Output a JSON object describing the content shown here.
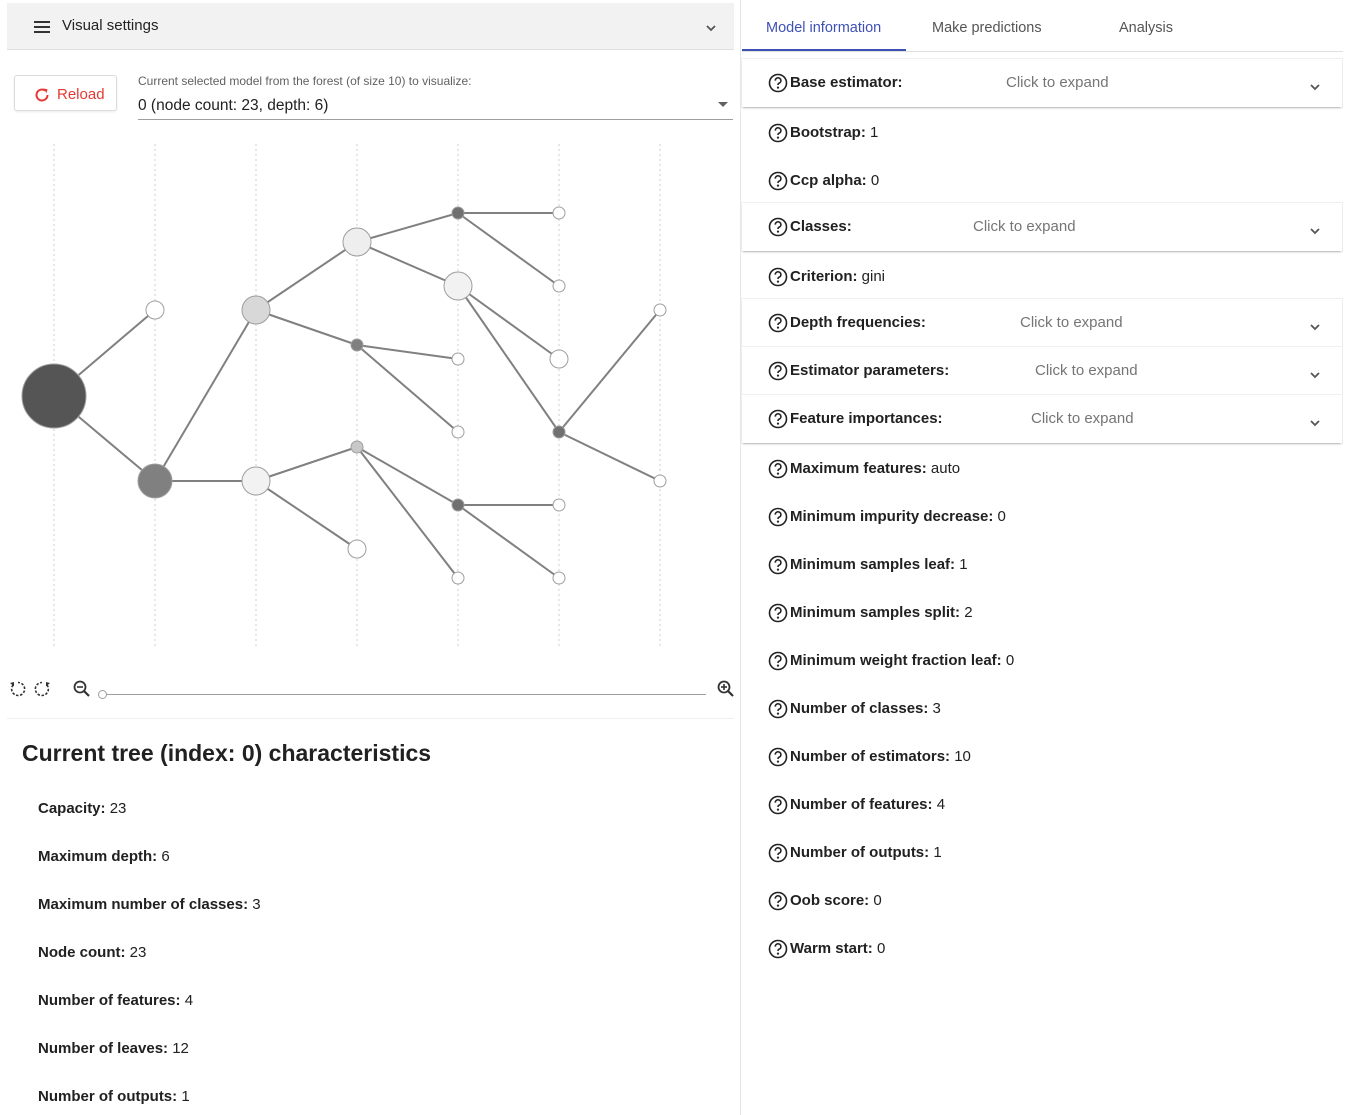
{
  "visual_settings": {
    "title": "Visual settings"
  },
  "reload": {
    "label": "Reload"
  },
  "model_select": {
    "label": "Current selected model from the forest (of size 10) to visualize:",
    "value": "0 (node count: 23, depth: 6)"
  },
  "zoom": {
    "level": 0.0
  },
  "tree_info": {
    "title": "Current tree (index: 0) characteristics",
    "stats": [
      {
        "label": "Capacity:",
        "value": "23"
      },
      {
        "label": "Maximum depth:",
        "value": "6"
      },
      {
        "label": "Maximum number of classes:",
        "value": "3"
      },
      {
        "label": "Node count:",
        "value": "23"
      },
      {
        "label": "Number of features:",
        "value": "4"
      },
      {
        "label": "Number of leaves:",
        "value": "12"
      },
      {
        "label": "Number of outputs:",
        "value": "1"
      }
    ]
  },
  "tabs": [
    {
      "label": "Model information"
    },
    {
      "label": "Make predictions"
    },
    {
      "label": "Analysis"
    }
  ],
  "model_info": {
    "expand_hint": "Click to expand",
    "rows": [
      {
        "label": "Base estimator:",
        "value": "",
        "expandable": true
      },
      {
        "label": "Bootstrap:",
        "value": "1"
      },
      {
        "label": "Ccp alpha:",
        "value": "0"
      },
      {
        "label": "Classes:",
        "value": "",
        "expandable": true
      },
      {
        "label": "Criterion:",
        "value": "gini"
      },
      {
        "label": "Depth frequencies:",
        "value": "",
        "expandable": true
      },
      {
        "label": "Estimator parameters:",
        "value": "",
        "expandable": true
      },
      {
        "label": "Feature importances:",
        "value": "",
        "expandable": true
      },
      {
        "label": "Maximum features:",
        "value": "auto"
      },
      {
        "label": "Minimum impurity decrease:",
        "value": "0"
      },
      {
        "label": "Minimum samples leaf:",
        "value": "1"
      },
      {
        "label": "Minimum samples split:",
        "value": "2"
      },
      {
        "label": "Minimum weight fraction leaf:",
        "value": "0"
      },
      {
        "label": "Number of classes:",
        "value": "3"
      },
      {
        "label": "Number of estimators:",
        "value": "10"
      },
      {
        "label": "Number of features:",
        "value": "4"
      },
      {
        "label": "Number of outputs:",
        "value": "1"
      },
      {
        "label": "Oob score:",
        "value": "0"
      },
      {
        "label": "Warm start:",
        "value": "0"
      }
    ]
  },
  "tree_graph": {
    "nodes": [
      {
        "id": 0,
        "depth": 0,
        "shade": "#555555",
        "size": 4
      },
      {
        "id": 1,
        "depth": 1,
        "shade": "#ffffff",
        "size": 1
      },
      {
        "id": 2,
        "depth": 1,
        "shade": "#808080",
        "size": 3
      },
      {
        "id": 3,
        "depth": 2,
        "shade": "#d8d8d8",
        "size": 2
      },
      {
        "id": 4,
        "depth": 2,
        "shade": "#f2f2f2",
        "size": 2
      },
      {
        "id": 5,
        "depth": 3,
        "shade": "#eeeeee",
        "size": 2
      },
      {
        "id": 6,
        "depth": 3,
        "shade": "#808080",
        "size": 0
      },
      {
        "id": 7,
        "depth": 3,
        "shade": "#c8c8c8",
        "size": 0
      },
      {
        "id": 8,
        "depth": 3,
        "shade": "#ffffff",
        "size": 1
      },
      {
        "id": 9,
        "depth": 4,
        "shade": "#707070",
        "size": 0
      },
      {
        "id": 10,
        "depth": 4,
        "shade": "#f2f2f2",
        "size": 2
      },
      {
        "id": 11,
        "depth": 4,
        "shade": "#ffffff",
        "size": 0
      },
      {
        "id": 12,
        "depth": 4,
        "shade": "#ffffff",
        "size": 0
      },
      {
        "id": 13,
        "depth": 4,
        "shade": "#707070",
        "size": 0
      },
      {
        "id": 14,
        "depth": 4,
        "shade": "#ffffff",
        "size": 0
      },
      {
        "id": 15,
        "depth": 5,
        "shade": "#ffffff",
        "size": 0
      },
      {
        "id": 16,
        "depth": 5,
        "shade": "#ffffff",
        "size": 0
      },
      {
        "id": 17,
        "depth": 5,
        "shade": "#ffffff",
        "size": 1
      },
      {
        "id": 18,
        "depth": 5,
        "shade": "#707070",
        "size": 0
      },
      {
        "id": 19,
        "depth": 5,
        "shade": "#ffffff",
        "size": 0
      },
      {
        "id": 20,
        "depth": 5,
        "shade": "#ffffff",
        "size": 0
      },
      {
        "id": 21,
        "depth": 6,
        "shade": "#ffffff",
        "size": 0
      },
      {
        "id": 22,
        "depth": 6,
        "shade": "#ffffff",
        "size": 0
      }
    ],
    "edges": [
      [
        0,
        1
      ],
      [
        0,
        2
      ],
      [
        2,
        3
      ],
      [
        2,
        4
      ],
      [
        3,
        5
      ],
      [
        3,
        6
      ],
      [
        4,
        7
      ],
      [
        4,
        8
      ],
      [
        5,
        9
      ],
      [
        5,
        10
      ],
      [
        6,
        11
      ],
      [
        6,
        12
      ],
      [
        7,
        13
      ],
      [
        7,
        14
      ],
      [
        9,
        15
      ],
      [
        9,
        16
      ],
      [
        10,
        17
      ],
      [
        10,
        18
      ],
      [
        13,
        19
      ],
      [
        13,
        20
      ],
      [
        18,
        21
      ],
      [
        18,
        22
      ]
    ]
  },
  "icons": {
    "menu": "menu-icon",
    "chevron": "chevron-down-icon",
    "reload": "reload-icon",
    "help": "help-circle-icon",
    "rotate_left": "rotate-left-icon",
    "rotate_right": "rotate-right-icon",
    "zoom_out": "zoom-out-icon",
    "zoom_in": "zoom-in-icon"
  },
  "colors": {
    "accent": "#3f51b5",
    "reload": "#e53935"
  }
}
